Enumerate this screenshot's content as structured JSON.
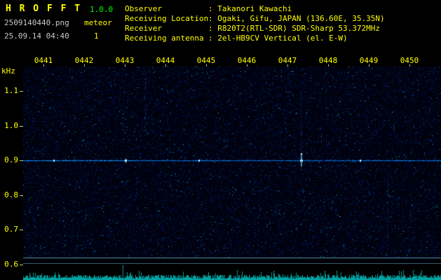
{
  "header": {
    "app_name": "H R O F F T",
    "version": "1.0.0",
    "filename": "2509140440.png",
    "mode_label": "meteor",
    "datetime": "25.09.14 04:40",
    "count": "1",
    "info_rows": [
      {
        "label": "Observer",
        "value": ": Takanori Kawachi"
      },
      {
        "label": "Receiving Location",
        "value": ": Ogaki, Gifu, JAPAN (136.60E, 35.35N)"
      },
      {
        "label": "Receiver",
        "value": ": R820T2(RTL-SDR) SDR-Sharp 53.372MHz"
      },
      {
        "label": "Receiving antenna",
        "value": ": 2el-HB9CV Vertical (el. E-W)"
      }
    ]
  },
  "spectrogram": {
    "freq_axis_unit": "kHz",
    "freq_labels": [
      "1.1",
      "1.0",
      "0.9",
      "0.8",
      "0.7",
      "0.6"
    ],
    "time_labels": [
      "0441",
      "0442",
      "0443",
      "0444",
      "0445",
      "0446",
      "0447",
      "0448",
      "0449",
      "0450"
    ],
    "carrier_freq_khz": "0.9"
  },
  "colors": {
    "background": "#000000",
    "label_yellow": "#ffff00",
    "version_green": "#00ff00",
    "text_white": "#c8c8c8",
    "noise_base_blue": "#000a28",
    "carrier_cyan": "#00ccff",
    "level_cyan": "#00cccc"
  }
}
